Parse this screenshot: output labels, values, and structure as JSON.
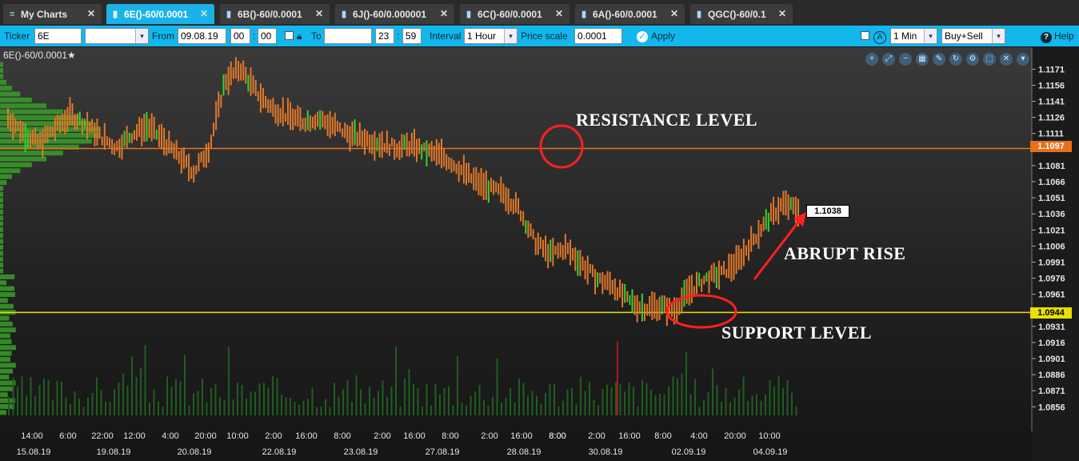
{
  "tabs": [
    {
      "label": "My Charts",
      "icon": "menu-icon",
      "active": false
    },
    {
      "label": "6E()-60/0.0001",
      "icon": "bar-chart-icon",
      "active": true
    },
    {
      "label": "6B()-60/0.0001",
      "icon": "bar-chart-icon",
      "active": false
    },
    {
      "label": "6J()-60/0.000001",
      "icon": "bar-chart-icon",
      "active": false
    },
    {
      "label": "6C()-60/0.0001",
      "icon": "bar-chart-icon",
      "active": false
    },
    {
      "label": "6A()-60/0.0001",
      "icon": "bar-chart-icon",
      "active": false
    },
    {
      "label": "QGC()-60/0.1",
      "icon": "bar-chart-icon",
      "active": false
    }
  ],
  "toolbar": {
    "ticker_label": "Ticker",
    "ticker_value": "6E",
    "from_label": "From",
    "from_date": "09.08.19",
    "from_hour": "00",
    "from_min": "00",
    "to_label": "To",
    "to_date": "",
    "to_hour": "23",
    "to_min": "59",
    "interval_label": "Interval",
    "interval_value": "1 Hour",
    "price_scale_label": "Price scale",
    "price_scale_value": "0.0001",
    "apply_label": "Apply",
    "timeframe_value": "1 Min",
    "side_value": "Buy+Sell",
    "help_label": "Help",
    "time_sep": ":"
  },
  "chart": {
    "title": "6E()-60/0.0001★",
    "resistance_label": "1.1097",
    "support_label": "1.0944",
    "last_price_label": "1.1038",
    "annotations": {
      "resistance": "RESISTANCE LEVEL",
      "support": "SUPPORT LEVEL",
      "rise": "ABRUPT RISE"
    },
    "colors": {
      "resistance": "#e8701a",
      "support": "#e8e000",
      "bars": "#e0782a",
      "up": "#2fd42f",
      "volume": "#1f5e1f",
      "profile": "#3a9d2a",
      "highlight": "#ff2020",
      "accent": "#1ab2e8"
    }
  },
  "chart_data": {
    "type": "bar",
    "y_ticks": [
      "1.1171",
      "1.1156",
      "1.1141",
      "1.1126",
      "1.1111",
      "1.1081",
      "1.1066",
      "1.1051",
      "1.1036",
      "1.1021",
      "1.1006",
      "1.0991",
      "1.0976",
      "1.0961",
      "1.0931",
      "1.0916",
      "1.0901",
      "1.0886",
      "1.0871",
      "1.0856"
    ],
    "ylim": [
      1.0848,
      1.1178
    ],
    "x_time_ticks": [
      "14:00",
      "6:00",
      "22:00",
      "12:00",
      "4:00",
      "20:00",
      "10:00",
      "2:00",
      "16:00",
      "8:00",
      "8:00",
      "2:00",
      "16:00",
      "8:00",
      "2:00",
      "16:00",
      "8:00",
      "2:00",
      "16:00",
      "8:00",
      "4:00",
      "20:00",
      "10:00"
    ],
    "x_date_ticks": [
      "15.08.19",
      "19.08.19",
      "20.08.19",
      "22.08.19",
      "23.08.19",
      "27.08.19",
      "28.08.19",
      "30.08.19",
      "02.09.19",
      "04.09.19"
    ],
    "resistance": 1.1097,
    "support": 1.0944,
    "last_price": 1.1038,
    "price_path": [
      1.1125,
      1.1112,
      1.1102,
      1.1115,
      1.1128,
      1.112,
      1.1108,
      1.1098,
      1.111,
      1.1118,
      1.1105,
      1.109,
      1.1075,
      1.1098,
      1.116,
      1.1172,
      1.115,
      1.1135,
      1.1128,
      1.1122,
      1.1125,
      1.1118,
      1.111,
      1.1106,
      1.1102,
      1.1098,
      1.11,
      1.1094,
      1.109,
      1.108,
      1.1068,
      1.106,
      1.1055,
      1.104,
      1.101,
      1.0998,
      1.1004,
      1.099,
      1.0975,
      1.097,
      1.0955,
      1.0948,
      1.095,
      1.0946,
      1.0965,
      1.0975,
      1.098,
      1.099,
      1.101,
      1.103,
      1.1045,
      1.104
    ]
  }
}
